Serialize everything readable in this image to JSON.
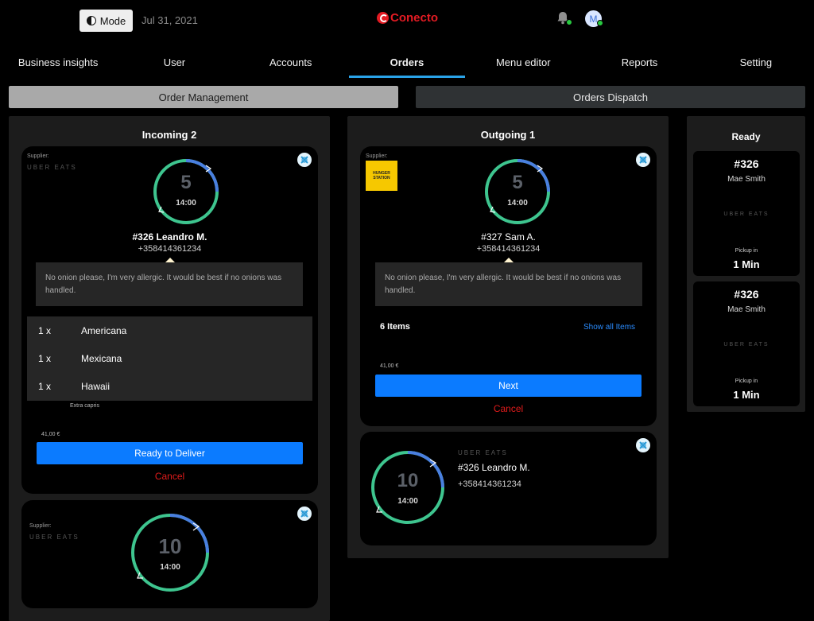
{
  "header": {
    "mode_label": "Mode",
    "date": "Jul 31, 2021",
    "logo_text": "Conecto",
    "avatar_initial": "M"
  },
  "nav": {
    "items": [
      "Business insights",
      "User",
      "Accounts",
      "Orders",
      "Menu editor",
      "Reports",
      "Setting"
    ],
    "active": "Orders"
  },
  "tabs": {
    "order_management": "Order Management",
    "orders_dispatch": "Orders Dispatch"
  },
  "incoming": {
    "title": "Incoming 2",
    "card1": {
      "supplier_label": "Supplier:",
      "supplier": "UBER EATS",
      "timer_minutes": "5",
      "timer_time": "14:00",
      "order": "#326 Leandro M.",
      "phone": "+358414361234",
      "note": "No onion please, I'm very allergic. It would be best if no onions was handled.",
      "items": [
        {
          "qty": "1 x",
          "name": "Americana"
        },
        {
          "qty": "1 x",
          "name": "Mexicana"
        },
        {
          "qty": "1 x",
          "name": "Hawaii"
        }
      ],
      "extra": "Extra capris",
      "price": "41,00 €",
      "primary_button": "Ready to Deliver",
      "cancel": "Cancel"
    },
    "card2": {
      "supplier_label": "Supplier:",
      "supplier": "UBER EATS",
      "timer_minutes": "10",
      "timer_time": "14:00"
    }
  },
  "outgoing": {
    "title": "Outgoing 1",
    "card1": {
      "supplier_label": "Supplier:",
      "supplier_logo": "HUNGER STATION",
      "timer_minutes": "5",
      "timer_time": "14:00",
      "order": "#327 Sam A.",
      "phone": "+358414361234",
      "note": "No onion please, I'm very allergic. It would be best if no onions was handled.",
      "items_count": "6 Items",
      "show_all": "Show all Items",
      "price": "41,00 €",
      "primary_button": "Next",
      "cancel": "Cancel"
    },
    "card2": {
      "supplier": "UBER EATS",
      "order": "#326 Leandro M.",
      "phone": "+358414361234",
      "timer_minutes": "10",
      "timer_time": "14:00"
    }
  },
  "ready": {
    "title": "Ready",
    "cards": [
      {
        "id": "#326",
        "name": "Mae Smith",
        "supplier": "UBER EATS",
        "pickup_label": "Pickup in",
        "pickup": "1 Min"
      },
      {
        "id": "#326",
        "name": "Mae Smith",
        "supplier": "UBER EATS",
        "pickup_label": "Pickup in",
        "pickup": "1 Min"
      }
    ]
  },
  "colors": {
    "accent_blue": "#0b7bff",
    "nav_underline": "#2aa3e8",
    "ring_green": "#3ec58f",
    "ring_blue": "#4a7fe0",
    "cancel_red": "#e01b1b",
    "brand_red": "#e31b23"
  }
}
